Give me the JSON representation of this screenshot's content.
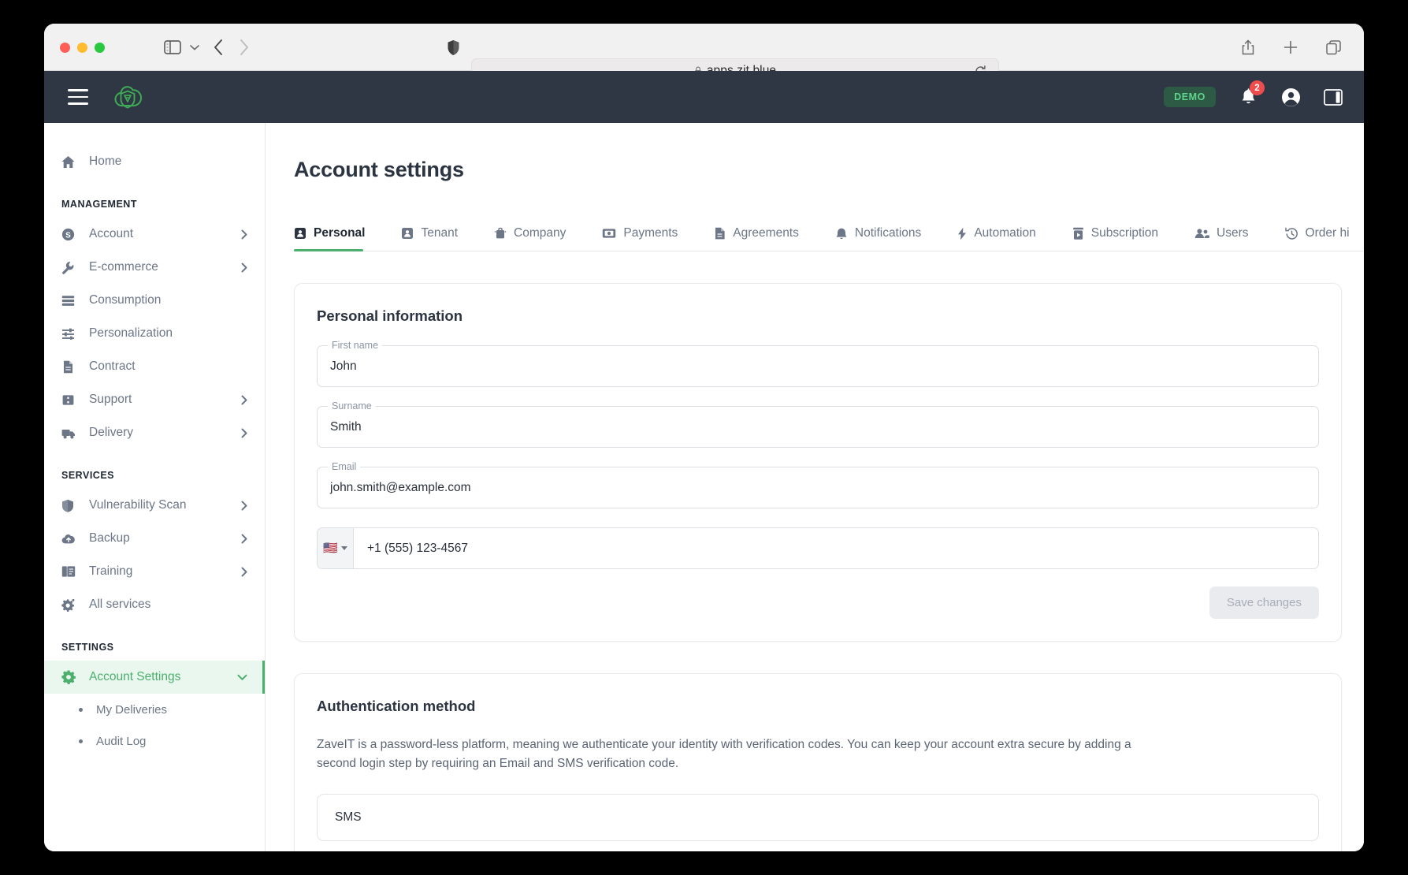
{
  "browser": {
    "url": "apps.zit.blue",
    "icons": {
      "sidebar_toggle": "sidebar-toggle-icon",
      "dropdown": "chevron-down-icon",
      "back": "back-arrow-icon",
      "forward": "forward-arrow-icon",
      "shield": "shield-privacy-icon",
      "lock": "lock-icon",
      "reload": "reload-icon",
      "share": "share-icon",
      "new_tab": "plus-icon",
      "tab_overview": "tab-overview-icon"
    }
  },
  "app_header": {
    "menu_label": "hamburger-menu",
    "logo_label": "zaveit-logo",
    "demo_badge": "DEMO",
    "notification_count": "2",
    "account_icon": "account-circle-icon",
    "panel_icon": "side-panel-icon"
  },
  "sidebar": {
    "top": [
      {
        "label": "Home",
        "icon": "home-icon",
        "expandable": false
      }
    ],
    "groups": [
      {
        "title": "MANAGEMENT",
        "items": [
          {
            "label": "Account",
            "icon": "coin-dollar-icon",
            "expandable": true
          },
          {
            "label": "E-commerce",
            "icon": "wrench-icon",
            "expandable": true
          },
          {
            "label": "Consumption",
            "icon": "list-lines-icon",
            "expandable": false
          },
          {
            "label": "Personalization",
            "icon": "sliders-icon",
            "expandable": false
          },
          {
            "label": "Contract",
            "icon": "document-icon",
            "expandable": false
          },
          {
            "label": "Support",
            "icon": "ticket-icon",
            "expandable": true
          },
          {
            "label": "Delivery",
            "icon": "truck-icon",
            "expandable": true
          }
        ]
      },
      {
        "title": "SERVICES",
        "items": [
          {
            "label": "Vulnerability Scan",
            "icon": "shield-icon",
            "expandable": true
          },
          {
            "label": "Backup",
            "icon": "cloud-upload-icon",
            "expandable": true
          },
          {
            "label": "Training",
            "icon": "book-icon",
            "expandable": true
          },
          {
            "label": "All services",
            "icon": "gear-sparkle-icon",
            "expandable": false
          }
        ]
      },
      {
        "title": "SETTINGS",
        "items": [
          {
            "label": "Account Settings",
            "icon": "gear-icon",
            "expandable": true,
            "active": true,
            "expanded": true
          }
        ],
        "subitems": [
          {
            "label": "My Deliveries"
          },
          {
            "label": "Audit Log"
          }
        ]
      }
    ]
  },
  "main": {
    "page_title": "Account settings",
    "tabs": [
      {
        "label": "Personal",
        "icon": "contact-card-icon",
        "active": true
      },
      {
        "label": "Tenant",
        "icon": "contact-card-icon",
        "active": false
      },
      {
        "label": "Company",
        "icon": "briefcase-icon",
        "active": false
      },
      {
        "label": "Payments",
        "icon": "banknote-icon",
        "active": false
      },
      {
        "label": "Agreements",
        "icon": "document-icon",
        "active": false
      },
      {
        "label": "Notifications",
        "icon": "bell-icon",
        "active": false
      },
      {
        "label": "Automation",
        "icon": "lightning-bolt-icon",
        "active": false
      },
      {
        "label": "Subscription",
        "icon": "subscription-box-icon",
        "active": false
      },
      {
        "label": "Users",
        "icon": "users-icon",
        "active": false
      },
      {
        "label": "Order hi",
        "icon": "history-clock-icon",
        "active": false
      }
    ],
    "personal_card": {
      "title": "Personal information",
      "fields": [
        {
          "label": "First name",
          "value": "John"
        },
        {
          "label": "Surname",
          "value": "Smith"
        },
        {
          "label": "Email",
          "value": "john.smith@example.com"
        }
      ],
      "phone": {
        "flag": "🇺🇸",
        "value": "+1 (555) 123-4567"
      },
      "save_label": "Save changes"
    },
    "auth_card": {
      "title": "Authentication method",
      "description": "ZaveIT is a password-less platform, meaning we authenticate your identity with verification codes. You can keep your account extra secure by adding a second login step by requiring an Email and SMS verification code.",
      "option_label": "SMS"
    }
  },
  "colors": {
    "accent_green": "#4caf6d",
    "header_dark": "#2f3745",
    "badge_red": "#ef4d4d",
    "text_dark": "#2c3442",
    "text_muted": "#6c7687"
  }
}
